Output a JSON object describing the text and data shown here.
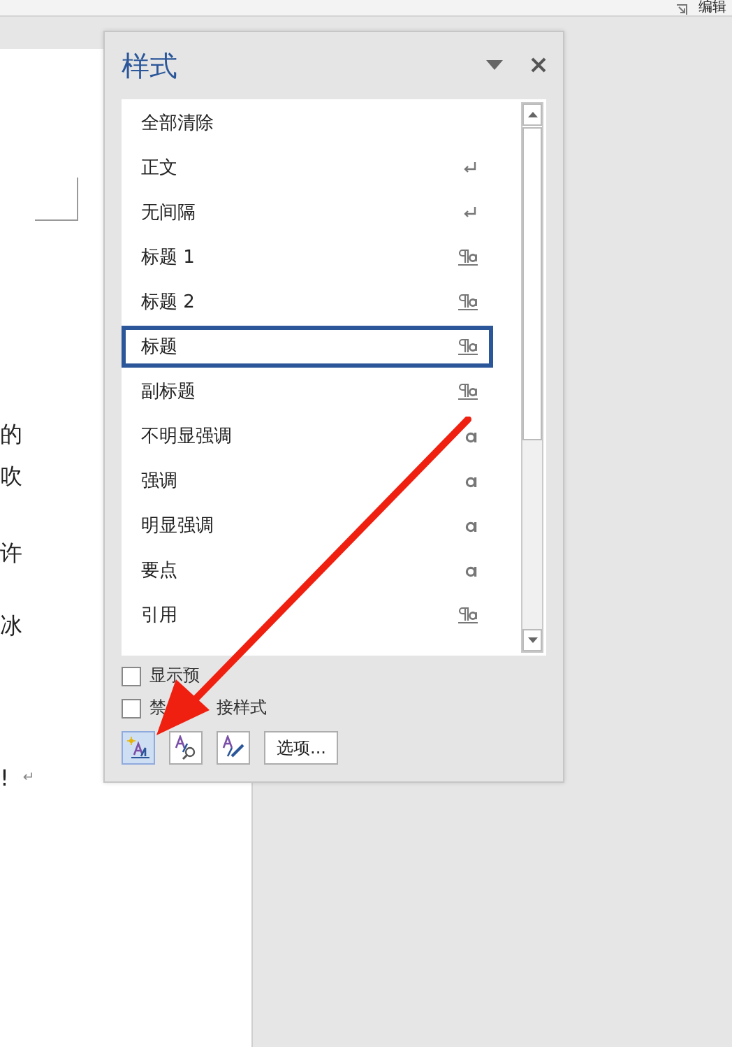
{
  "ribbon": {
    "group_label": "编辑"
  },
  "document": {
    "lines": [
      {
        "text": "的"
      },
      {
        "text": "吹"
      },
      {
        "text": "许"
      },
      {
        "text": "冰"
      },
      {
        "text": "!",
        "return_mark": "↵"
      }
    ]
  },
  "styles_pane": {
    "title": "样式",
    "styles": [
      {
        "name": "全部清除",
        "kind": "none",
        "selected": false
      },
      {
        "name": "正文",
        "kind": "paragraph",
        "selected": false
      },
      {
        "name": "无间隔",
        "kind": "paragraph",
        "selected": false
      },
      {
        "name": "标题 1",
        "kind": "linked",
        "selected": false
      },
      {
        "name": "标题 2",
        "kind": "linked",
        "selected": false
      },
      {
        "name": "标题",
        "kind": "linked",
        "selected": true
      },
      {
        "name": "副标题",
        "kind": "linked",
        "selected": false
      },
      {
        "name": "不明显强调",
        "kind": "character",
        "selected": false
      },
      {
        "name": "强调",
        "kind": "character",
        "selected": false
      },
      {
        "name": "明显强调",
        "kind": "character",
        "selected": false
      },
      {
        "name": "要点",
        "kind": "character",
        "selected": false
      },
      {
        "name": "引用",
        "kind": "linked",
        "selected": false
      }
    ],
    "options": [
      {
        "label_parts": [
          "显示预"
        ],
        "checked": false
      },
      {
        "label_parts": [
          "禁",
          "接样式"
        ],
        "checked": false
      }
    ],
    "options_button": "选项..."
  }
}
